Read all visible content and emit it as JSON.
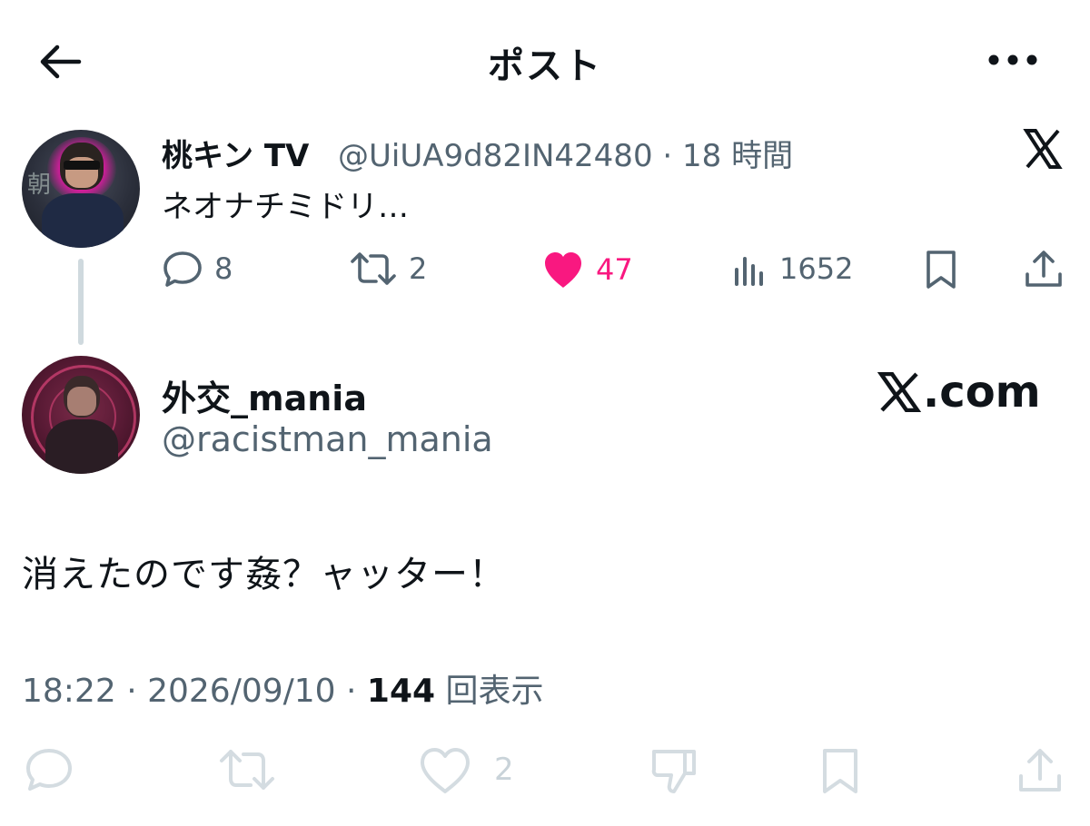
{
  "header": {
    "title": "ポスト",
    "back_icon": "arrow-left-icon",
    "more_icon": "more-horizontal-icon"
  },
  "parent_post": {
    "display_name": "桃キン TV",
    "handle_and_time": "@UiUA9d82IN42480 · 18 時間",
    "text": "ネオナチミドリ…",
    "actions": {
      "replies": "8",
      "reposts": "2",
      "likes": "47",
      "views": "1652"
    },
    "liked": true,
    "like_color": "#f91880"
  },
  "post": {
    "display_name": "外交_mania",
    "handle": "@racistman_mania",
    "watermark_suffix": ".com",
    "text": "消えたのです姦？ャッター！",
    "timestamp": "18:22 · 2026/09/10 · ",
    "views_count": "144",
    "views_label": " 回表示",
    "bottom_actions": {
      "likes": "2"
    }
  },
  "colors": {
    "text": "#0f1419",
    "muted": "#536471",
    "faded_icon": "#d4dce1",
    "thread_line": "#cfd9de",
    "accent_like": "#f91880"
  }
}
